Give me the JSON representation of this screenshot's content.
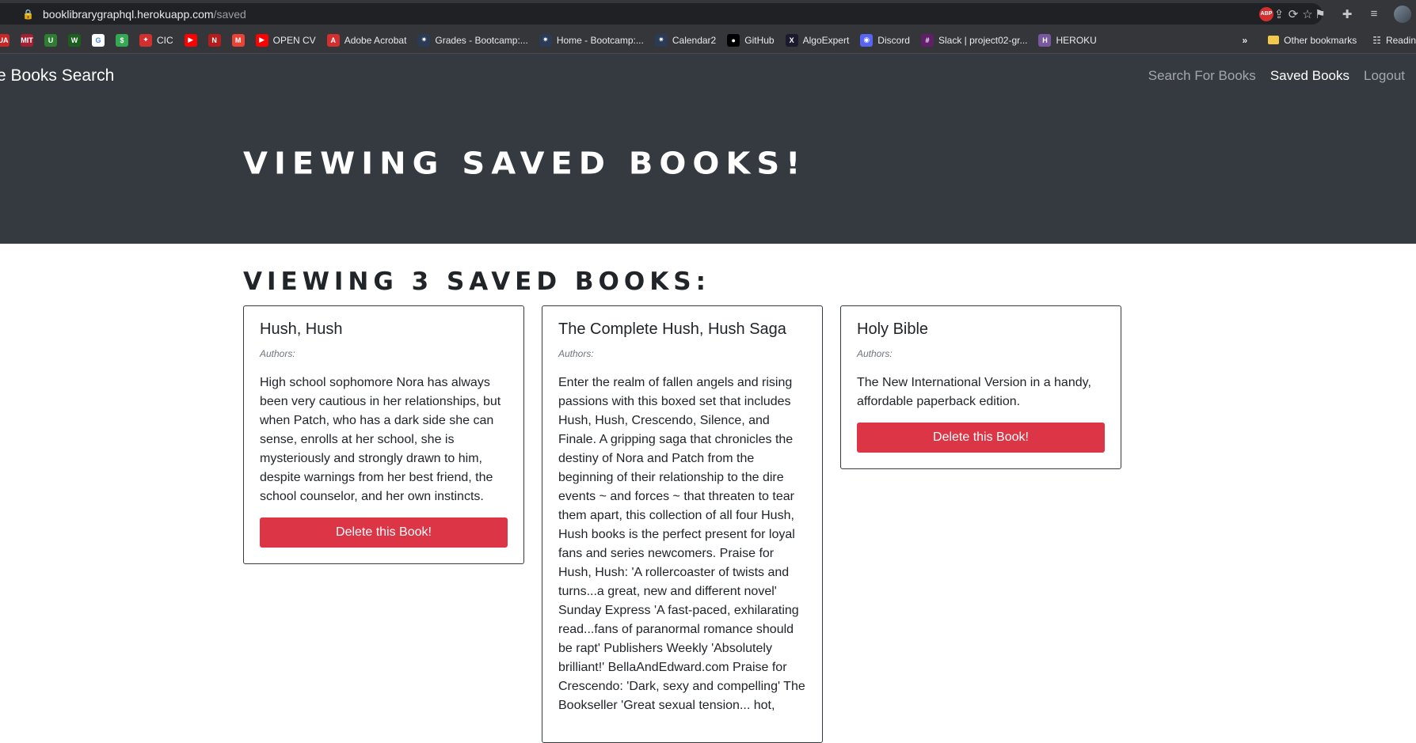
{
  "browser": {
    "url_host": "booklibrarygraphql.herokuapp.com",
    "url_path": "/saved",
    "bookmarks": [
      {
        "label": "",
        "icon": "ua-icon",
        "color": "#c62828",
        "glyph": "UA"
      },
      {
        "label": "",
        "icon": "mit-ocw-icon",
        "color": "#a31f34",
        "glyph": "MIT"
      },
      {
        "label": "",
        "icon": "u-icon",
        "color": "#2e7d32",
        "glyph": "U"
      },
      {
        "label": "",
        "icon": "w-icon",
        "color": "#1b5e20",
        "glyph": "W"
      },
      {
        "label": "",
        "icon": "google-icon",
        "color": "#ffffff",
        "glyph": "G"
      },
      {
        "label": "",
        "icon": "money-icon",
        "color": "#34a853",
        "glyph": "$"
      },
      {
        "label": "CIC",
        "icon": "maple-leaf-icon",
        "color": "#d32f2f",
        "glyph": "✦"
      },
      {
        "label": "",
        "icon": "youtube-icon",
        "color": "#ff0000",
        "glyph": "▶"
      },
      {
        "label": "",
        "icon": "netflix-icon",
        "color": "#b71c1c",
        "glyph": "N"
      },
      {
        "label": "",
        "icon": "gmail-icon",
        "color": "#ea4335",
        "glyph": "M"
      },
      {
        "label": "OPEN CV",
        "icon": "youtube-icon",
        "color": "#ff0000",
        "glyph": "▶"
      },
      {
        "label": "Adobe Acrobat",
        "icon": "acrobat-icon",
        "color": "#d32f2f",
        "glyph": "A"
      },
      {
        "label": "Grades - Bootcamp:...",
        "icon": "bootcamp-icon",
        "color": "#2b3a55",
        "glyph": "✷"
      },
      {
        "label": "Home - Bootcamp:...",
        "icon": "bootcamp-icon",
        "color": "#2b3a55",
        "glyph": "✷"
      },
      {
        "label": "Calendar2",
        "icon": "bootcamp-icon",
        "color": "#2b3a55",
        "glyph": "✷"
      },
      {
        "label": "GitHub",
        "icon": "github-icon",
        "color": "#000000",
        "glyph": "●"
      },
      {
        "label": "AlgoExpert",
        "icon": "algoexpert-icon",
        "color": "#1a1a2e",
        "glyph": "X"
      },
      {
        "label": "Discord",
        "icon": "discord-icon",
        "color": "#5865f2",
        "glyph": "◉"
      },
      {
        "label": "Slack | project02-gr...",
        "icon": "slack-icon",
        "color": "#611f69",
        "glyph": "#"
      },
      {
        "label": "HEROKU",
        "icon": "heroku-icon",
        "color": "#79589f",
        "glyph": "H"
      }
    ],
    "overflow_label": "»",
    "other_bookmarks": "Other bookmarks",
    "reading_list": "Readin"
  },
  "navbar": {
    "brand": "e Books Search",
    "links": [
      "Search For Books",
      "Saved Books",
      "Logout"
    ]
  },
  "hero": {
    "title": "VIEWING SAVED BOOKS!"
  },
  "content": {
    "count_title": "VIEWING 3 SAVED BOOKS:"
  },
  "books": [
    {
      "title": "Hush, Hush",
      "authors": "Authors:",
      "description": "High school sophomore Nora has always been very cautious in her relationships, but when Patch, who has a dark side she can sense, enrolls at her school, she is mysteriously and strongly drawn to him, despite warnings from her best friend, the school counselor, and her own instincts.",
      "delete_label": "Delete this Book!"
    },
    {
      "title": "The Complete Hush, Hush Saga",
      "authors": "Authors:",
      "description": "Enter the realm of fallen angels and rising passions with this boxed set that includes Hush, Hush, Crescendo, Silence, and Finale. A gripping saga that chronicles the destiny of Nora and Patch from the beginning of their relationship to the dire events ~ and forces ~ that threaten to tear them apart, this collection of all four Hush, Hush books is the perfect present for loyal fans and series newcomers. Praise for Hush, Hush: 'A rollercoaster of twists and turns...a great, new and different novel' Sunday Express 'A fast-paced, exhilarating read...fans of paranormal romance should be rapt' Publishers Weekly 'Absolutely brilliant!' BellaAndEdward.com Praise for Crescendo: 'Dark, sexy and compelling' The Bookseller 'Great sexual tension... hot,",
      "delete_label": "Delete this Book!"
    },
    {
      "title": "Holy Bible",
      "authors": "Authors:",
      "description": "The New International Version in a handy, affordable paperback edition.",
      "delete_label": "Delete this Book!"
    }
  ]
}
